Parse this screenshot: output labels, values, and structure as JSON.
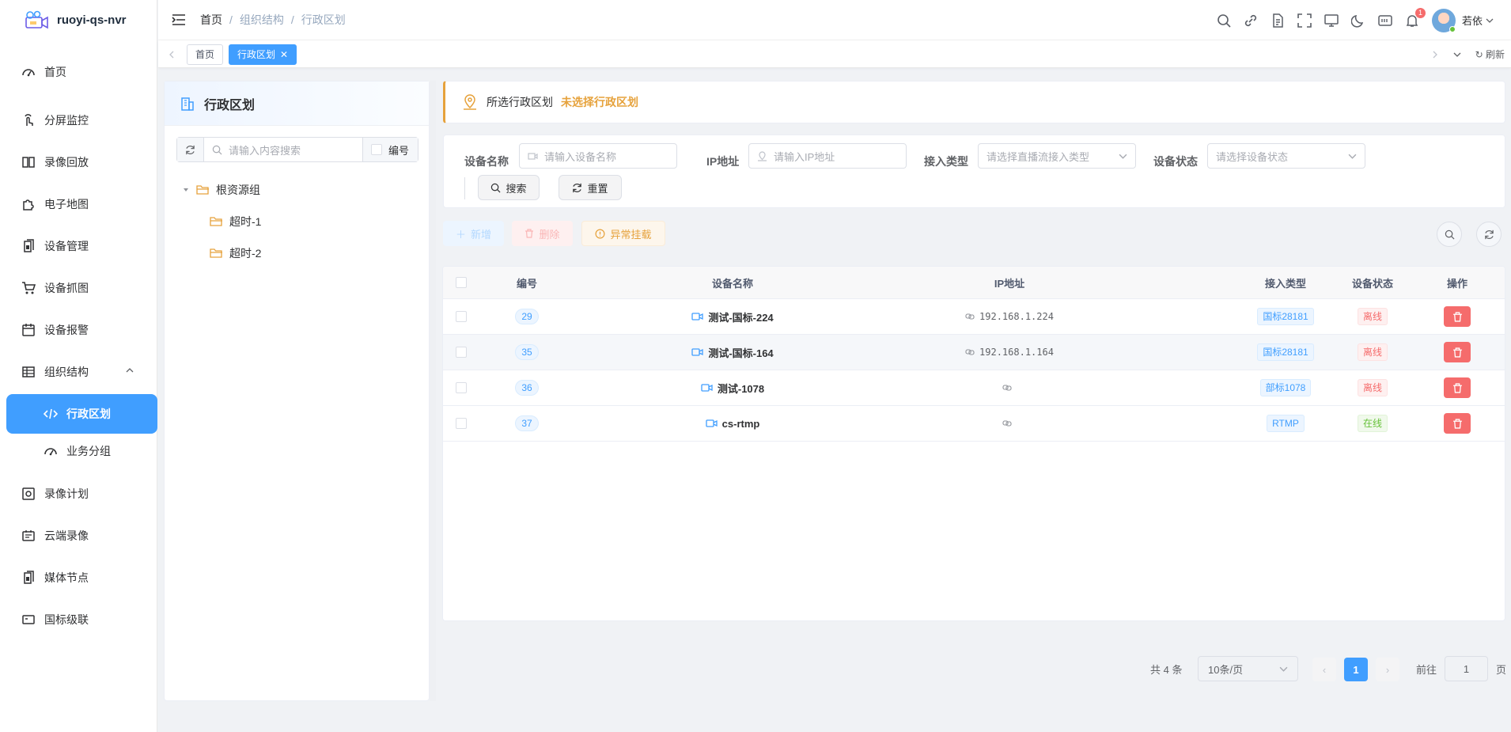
{
  "app": {
    "title": "ruoyi-qs-nvr"
  },
  "sidebar": {
    "items": [
      {
        "label": "首页",
        "icon": "dashboard-icon"
      },
      {
        "label": "分屏监控",
        "icon": "touch-icon"
      },
      {
        "label": "录像回放",
        "icon": "book-icon"
      },
      {
        "label": "电子地图",
        "icon": "puzzle-icon"
      },
      {
        "label": "设备管理",
        "icon": "documents-icon"
      },
      {
        "label": "设备抓图",
        "icon": "cart-icon"
      },
      {
        "label": "设备报警",
        "icon": "calendar-icon"
      },
      {
        "label": "组织结构",
        "icon": "table-icon"
      },
      {
        "label": "行政区划",
        "icon": "code-icon"
      },
      {
        "label": "业务分组",
        "icon": "dashboard-icon"
      },
      {
        "label": "录像计划",
        "icon": "settings-box-icon"
      },
      {
        "label": "云端录像",
        "icon": "cloud-record-icon"
      },
      {
        "label": "媒体节点",
        "icon": "documents-icon"
      },
      {
        "label": "国标级联",
        "icon": "monitor-icon"
      }
    ]
  },
  "header": {
    "breadcrumb": [
      "首页",
      "组织结构",
      "行政区划"
    ],
    "notification_count": "1",
    "user_name": "若依"
  },
  "tags": {
    "items": [
      "首页",
      "行政区划"
    ],
    "refresh_label": "刷新"
  },
  "tree": {
    "title": "行政区划",
    "search_placeholder": "请输入内容搜索",
    "number_label": "编号",
    "root": "根资源组",
    "children": [
      "超时-1",
      "超时-2"
    ]
  },
  "alert": {
    "label": "所选行政区划",
    "value": "未选择行政区划"
  },
  "filters": {
    "device_name_label": "设备名称",
    "device_name_placeholder": "请输入设备名称",
    "ip_label": "IP地址",
    "ip_placeholder": "请输入IP地址",
    "access_type_label": "接入类型",
    "access_type_placeholder": "请选择直播流接入类型",
    "status_label": "设备状态",
    "status_placeholder": "请选择设备状态",
    "search_button": "搜索",
    "reset_button": "重置"
  },
  "actions": {
    "add": "新增",
    "delete": "删除",
    "abnormal_mount": "异常挂载"
  },
  "table": {
    "columns": [
      "编号",
      "设备名称",
      "IP地址",
      "接入类型",
      "设备状态",
      "操作"
    ],
    "rows": [
      {
        "id": "29",
        "name": "测试-国标-224",
        "ip": "192.168.1.224",
        "type": "国标28181",
        "status": "离线",
        "status_kind": "offline"
      },
      {
        "id": "35",
        "name": "测试-国标-164",
        "ip": "192.168.1.164",
        "type": "国标28181",
        "status": "离线",
        "status_kind": "offline"
      },
      {
        "id": "36",
        "name": "测试-1078",
        "ip": "",
        "type": "部标1078",
        "status": "离线",
        "status_kind": "offline"
      },
      {
        "id": "37",
        "name": "cs-rtmp",
        "ip": "",
        "type": "RTMP",
        "status": "在线",
        "status_kind": "online"
      }
    ]
  },
  "pagination": {
    "total": "共 4 条",
    "page_size": "10条/页",
    "current_page": "1",
    "goto_label": "前往",
    "goto_value": "1",
    "page_suffix": "页"
  },
  "colors": {
    "primary": "#409eff",
    "danger": "#f56c6c",
    "warning": "#e6a23c",
    "success": "#67c23a"
  }
}
